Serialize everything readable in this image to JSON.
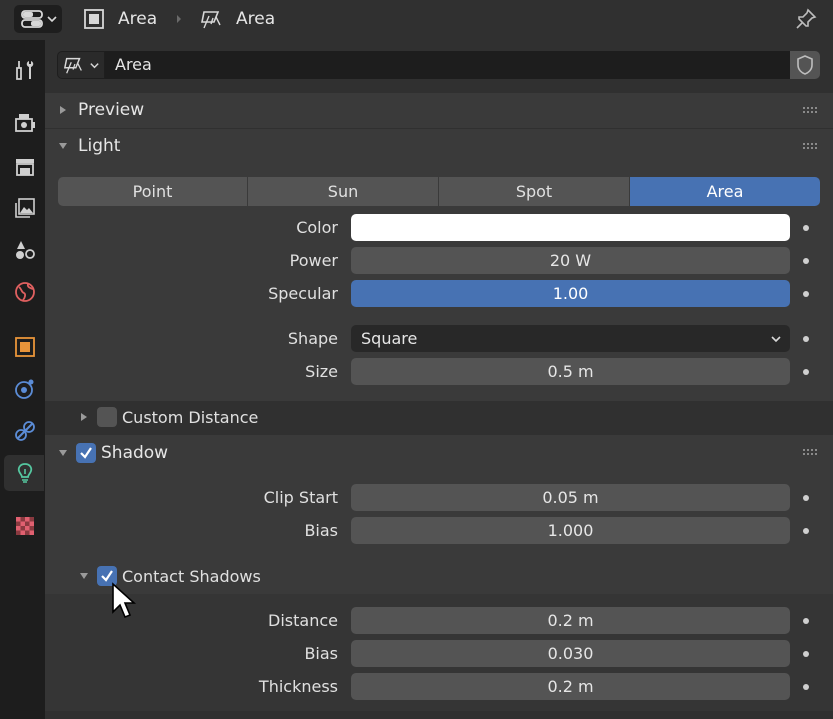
{
  "header": {
    "crumbs": [
      {
        "label": "Area",
        "icon": "object-icon"
      },
      {
        "label": "Area",
        "icon": "area-light-icon"
      }
    ]
  },
  "tabs": [
    {
      "name": "tool",
      "icon": "wrench-icon"
    },
    {
      "name": "render",
      "icon": "render-icon"
    },
    {
      "name": "output",
      "icon": "printer-icon"
    },
    {
      "name": "view-layer",
      "icon": "image-icon"
    },
    {
      "name": "scene",
      "icon": "scene-icon"
    },
    {
      "name": "world",
      "icon": "world-icon"
    },
    {
      "name": "object",
      "icon": "object-icon"
    },
    {
      "name": "physics",
      "icon": "physics-icon"
    },
    {
      "name": "constraints",
      "icon": "constraint-icon"
    },
    {
      "name": "light-data",
      "icon": "bulb-icon",
      "active": true
    },
    {
      "name": "texture",
      "icon": "checker-icon"
    }
  ],
  "context": {
    "datablock_name": "Area"
  },
  "panels": {
    "preview": {
      "title": "Preview"
    },
    "light": {
      "title": "Light",
      "types": [
        "Point",
        "Sun",
        "Spot",
        "Area"
      ],
      "active_type": "Area",
      "color_label": "Color",
      "color_value": "#ffffff",
      "power_label": "Power",
      "power_value": "20 W",
      "specular_label": "Specular",
      "specular_value": "1.00",
      "shape_label": "Shape",
      "shape_value": "Square",
      "size_label": "Size",
      "size_value": "0.5 m",
      "custom_distance_label": "Custom Distance"
    },
    "shadow": {
      "title": "Shadow",
      "clip_start_label": "Clip Start",
      "clip_start_value": "0.05 m",
      "bias_label": "Bias",
      "bias_value": "1.000",
      "contact": {
        "title": "Contact Shadows",
        "distance_label": "Distance",
        "distance_value": "0.2 m",
        "bias_label": "Bias",
        "bias_value": "0.030",
        "thickness_label": "Thickness",
        "thickness_value": "0.2 m"
      }
    }
  },
  "colors": {
    "accent": "#4772b3",
    "panel": "#3a3a3a",
    "background": "#303030",
    "tab_column": "#1d1d1d",
    "field": "#545454"
  }
}
